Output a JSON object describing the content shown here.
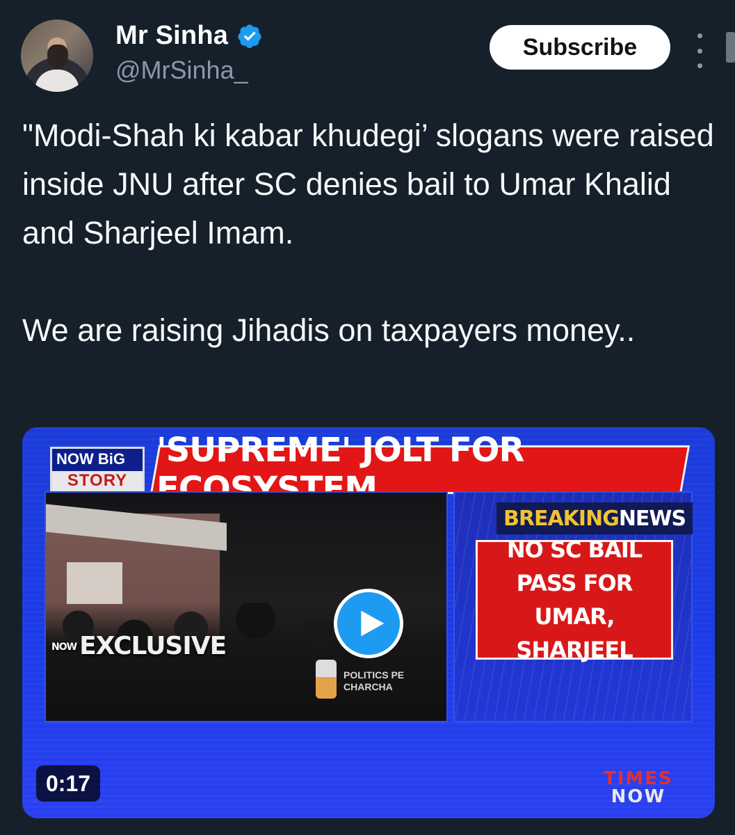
{
  "author": {
    "display_name": "Mr Sinha",
    "handle": "@MrSinha_",
    "verified": true,
    "verified_icon": "verified-badge-icon",
    "avatar_icon": "profile-photo"
  },
  "actions": {
    "subscribe_label": "Subscribe",
    "more_icon": "more-vertical-icon"
  },
  "tweet": {
    "text": "\"Modi-Shah ki kabar khudegi’ slogans were raised inside JNU after SC denies bail to Umar Khalid and Sharjeel Imam.\n\nWe are raising Jihadis on taxpayers money.."
  },
  "media": {
    "type": "video",
    "duration": "0:17",
    "play_icon": "play-icon",
    "bigstory_top": "NOW BiG",
    "bigstory_bottom": "STORY",
    "headline": "'SUPREME' JOLT FOR ECOSYSTEM",
    "exclusive_small": "NOW",
    "exclusive": "EXCLUSIVE",
    "politics": "POLITICS PE\nCHARCHA",
    "breaking_1": "BREAKING",
    "breaking_2": "NEWS",
    "red_box_text": "NO SC BAIL PASS FOR\nUMAR, SHARJEEL",
    "channel_logo_1": "TIMES",
    "channel_logo_2": "NOW"
  },
  "colors": {
    "background": "#15202b",
    "accent": "#1d9bf0",
    "secondary_text": "#8b98a5",
    "news_red": "#e21616",
    "news_blue": "#1c3be8"
  }
}
